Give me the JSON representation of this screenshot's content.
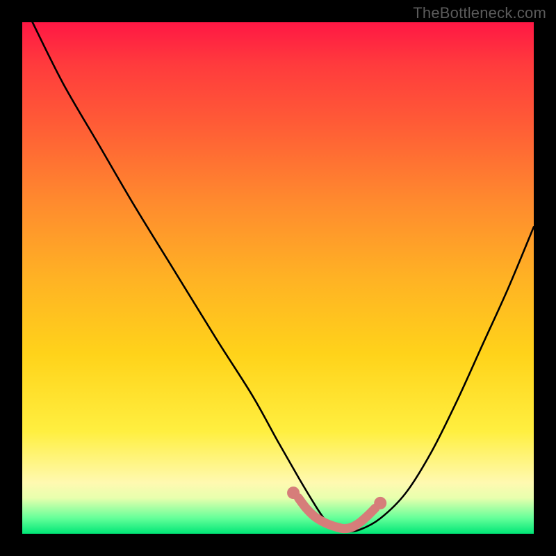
{
  "watermark": "TheBottleneck.com",
  "domain": "Chart",
  "chart_data": {
    "type": "line",
    "title": "",
    "xlabel": "",
    "ylabel": "",
    "xlim": [
      0,
      100
    ],
    "ylim": [
      0,
      100
    ],
    "series": [
      {
        "name": "main-curve",
        "x": [
          2,
          8,
          15,
          22,
          30,
          38,
          45,
          50,
          54,
          57,
          59,
          61,
          63,
          66,
          70,
          75,
          80,
          85,
          90,
          95,
          100
        ],
        "values": [
          100,
          88,
          76,
          64,
          51,
          38,
          27,
          18,
          11,
          6,
          3,
          1,
          0.4,
          0.8,
          3,
          8,
          16,
          26,
          37,
          48,
          60
        ]
      },
      {
        "name": "valley-marker",
        "x": [
          54,
          55.5,
          57,
          58.5,
          60,
          61.5,
          63,
          64.5,
          66,
          67.5,
          69
        ],
        "values": [
          7,
          5,
          3.5,
          2.5,
          1.8,
          1.3,
          1.0,
          1.3,
          2.2,
          3.5,
          5
        ]
      }
    ],
    "valley_endpoints": {
      "left": {
        "x": 53,
        "y": 8
      },
      "right": {
        "x": 70,
        "y": 6
      }
    },
    "colors": {
      "curve": "#000000",
      "marker": "#d67d7a",
      "gradient_top": "#ff1744",
      "gradient_mid1": "#ff8a2e",
      "gradient_mid2": "#ffef40",
      "gradient_bottom": "#00e676"
    }
  }
}
